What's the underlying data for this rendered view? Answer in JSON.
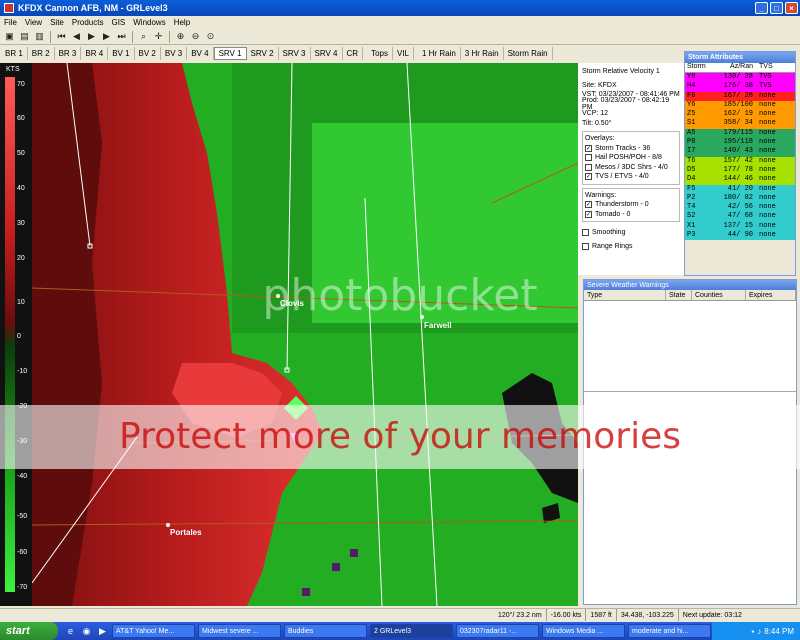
{
  "window": {
    "title": "KFDX Cannon AFB, NM - GRLevel3"
  },
  "menu": [
    "File",
    "View",
    "Site",
    "Products",
    "GIS",
    "Windows",
    "Help"
  ],
  "tabs": [
    "BR 1",
    "BR 2",
    "BR 3",
    "BR 4",
    "BV 1",
    "BV 2",
    "BV 3",
    "BV 4",
    "SRV 1",
    "SRV 2",
    "SRV 3",
    "SRV 4",
    "CR",
    "Tops",
    "VIL",
    "1 Hr Rain",
    "3 Hr Rain",
    "Storm Rain"
  ],
  "active_tab": "SRV 1",
  "legend": {
    "unit": "KTS",
    "ticks": [
      "70",
      "60",
      "50",
      "40",
      "30",
      "20",
      "10",
      "0",
      "-10",
      "-20",
      "-30",
      "-40",
      "-50",
      "-60",
      "-70"
    ]
  },
  "map": {
    "cities": [
      "Clovis",
      "Farwell",
      "Portales"
    ]
  },
  "info": {
    "product": "Storm Relative Velocity 1",
    "site": "Site:  KFDX",
    "vst": "VST:  03/23/2007 - 08:41:46 PM",
    "prod": "Prod: 03/23/2007 - 08:42:19 PM",
    "vcp": "VCP:  12",
    "tilt": "Tilt:  0.50°",
    "overlays_label": "Overlays:",
    "overlays": [
      {
        "label": "Storm Tracks - 36",
        "checked": true
      },
      {
        "label": "Hail POSH/POH - 8/8",
        "checked": false
      },
      {
        "label": "Mesos / 3DC Shrs - 4/0",
        "checked": false
      },
      {
        "label": "TVS / ETVS - 4/0",
        "checked": true
      }
    ],
    "warnings_label": "Warnings:",
    "warnings": [
      {
        "label": "Thunderstorm - 0",
        "checked": true
      },
      {
        "label": "Tornado - 0",
        "checked": true
      }
    ],
    "smoothing": "Smoothing",
    "range_rings": "Range Rings"
  },
  "storm_attributes": {
    "title": "Storm Attributes",
    "headers": [
      "Storm",
      "Az/Ran",
      "TVS"
    ],
    "rows": [
      {
        "id": "Y8",
        "az": "130/ 28",
        "tvs": "TVS",
        "color": "#ff00ff"
      },
      {
        "id": "H4",
        "az": "176/ 38",
        "tvs": "TVS",
        "color": "#ff00ff"
      },
      {
        "id": "F6",
        "az": "167/ 28",
        "tvs": "none",
        "color": "#ff2020"
      },
      {
        "id": "Y6",
        "az": "185/100",
        "tvs": "none",
        "color": "#ff9a00"
      },
      {
        "id": "Z5",
        "az": "162/ 19",
        "tvs": "none",
        "color": "#ff9a00"
      },
      {
        "id": "S1",
        "az": "358/ 34",
        "tvs": "none",
        "color": "#ff9a00"
      },
      {
        "id": "A5",
        "az": "179/115",
        "tvs": "none",
        "color": "#2aa860"
      },
      {
        "id": "P8",
        "az": "195/118",
        "tvs": "none",
        "color": "#2aa860"
      },
      {
        "id": "I7",
        "az": "140/ 43",
        "tvs": "none",
        "color": "#2aa860"
      },
      {
        "id": "T6",
        "az": "157/ 42",
        "tvs": "none",
        "color": "#a8e000"
      },
      {
        "id": "D5",
        "az": "177/ 78",
        "tvs": "none",
        "color": "#a8e000"
      },
      {
        "id": "D4",
        "az": "144/ 46",
        "tvs": "none",
        "color": "#a8e000"
      },
      {
        "id": "F5",
        "az": " 41/ 20",
        "tvs": "none",
        "color": "#33cccc"
      },
      {
        "id": "P2",
        "az": "180/ 82",
        "tvs": "none",
        "color": "#33cccc"
      },
      {
        "id": "T4",
        "az": " 42/ 56",
        "tvs": "none",
        "color": "#33cccc"
      },
      {
        "id": "S2",
        "az": " 47/ 68",
        "tvs": "none",
        "color": "#33cccc"
      },
      {
        "id": "X1",
        "az": "137/ 15",
        "tvs": "none",
        "color": "#33cccc"
      },
      {
        "id": "P3",
        "az": " 44/ 90",
        "tvs": "none",
        "color": "#33cccc"
      }
    ]
  },
  "severe_warnings": {
    "title": "Severe Weather Warnings",
    "headers": [
      "Type",
      "State",
      "Counties",
      "Expires"
    ]
  },
  "status_bar": [
    "120°/ 23.2 nm",
    "-16.00 kts",
    "1587 ft",
    "34.438, -103.225",
    "Next update: 03:12"
  ],
  "taskbar": {
    "start": "start",
    "tasks": [
      "AT&T Yahoo! Me...",
      "Midwest severe ...",
      "Buddies",
      "2 GRLevel3",
      "032307radar11 -...",
      "Windows Media ...",
      "moderate and hi..."
    ],
    "clock": "8:44 PM"
  },
  "watermark": {
    "line1": "photobucket",
    "line2": "Protect more of your memories"
  }
}
